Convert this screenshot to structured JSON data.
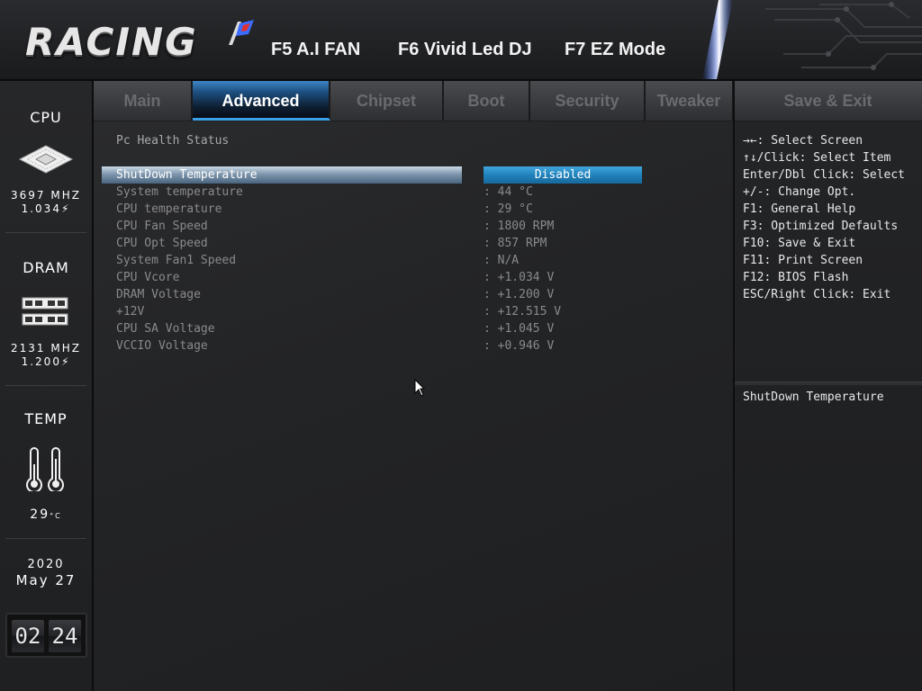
{
  "header": {
    "logo_text": "RACING",
    "hotkeys": [
      "F5 A.I FAN",
      "F6 Vivid Led DJ",
      "F7 EZ Mode"
    ]
  },
  "tabs": [
    {
      "label": "Main",
      "active": false
    },
    {
      "label": "Advanced",
      "active": true
    },
    {
      "label": "Chipset",
      "active": false
    },
    {
      "label": "Boot",
      "active": false
    },
    {
      "label": "Security",
      "active": false
    },
    {
      "label": "Tweaker",
      "active": false
    },
    {
      "label": "Save & Exit",
      "active": false
    }
  ],
  "sidebar": {
    "cpu": {
      "title": "CPU",
      "freq": "3697 MHZ",
      "volt": "1.034"
    },
    "dram": {
      "title": "DRAM",
      "freq": "2131 MHZ",
      "volt": "1.200"
    },
    "temp": {
      "title": "TEMP",
      "value": "29"
    },
    "date": {
      "year": "2020",
      "month_day": "May 27"
    },
    "clock": {
      "hours": "02",
      "minutes": "24"
    }
  },
  "main": {
    "section_title": "Pc Health Status",
    "selected": {
      "label": "ShutDown Temperature",
      "value": "Disabled"
    },
    "rows": [
      {
        "label": "System temperature",
        "value": ": 44 °C"
      },
      {
        "label": "CPU temperature",
        "value": ": 29 °C"
      },
      {
        "label": "CPU Fan Speed",
        "value": ": 1800 RPM"
      },
      {
        "label": "CPU Opt Speed",
        "value": ": 857 RPM"
      },
      {
        "label": "System Fan1 Speed",
        "value": ": N/A"
      },
      {
        "label": "CPU Vcore",
        "value": ": +1.034 V"
      },
      {
        "label": "DRAM Voltage",
        "value": ": +1.200 V"
      },
      {
        "label": "+12V",
        "value": ": +12.515 V"
      },
      {
        "label": "CPU SA Voltage",
        "value": ": +1.045 V"
      },
      {
        "label": "VCCIO Voltage",
        "value": ": +0.946 V"
      }
    ]
  },
  "help": {
    "keys": [
      "→←: Select Screen",
      "↑↓/Click: Select Item",
      "Enter/Dbl Click: Select",
      "+/-: Change Opt.",
      "F1: General Help",
      "F3: Optimized Defaults",
      "F10: Save & Exit",
      "F11: Print Screen",
      "F12: BIOS Flash",
      "ESC/Right Click: Exit"
    ],
    "description": "ShutDown Temperature"
  },
  "colors": {
    "accent": "#1f7fb8",
    "tab_active": "#1d4f80"
  }
}
